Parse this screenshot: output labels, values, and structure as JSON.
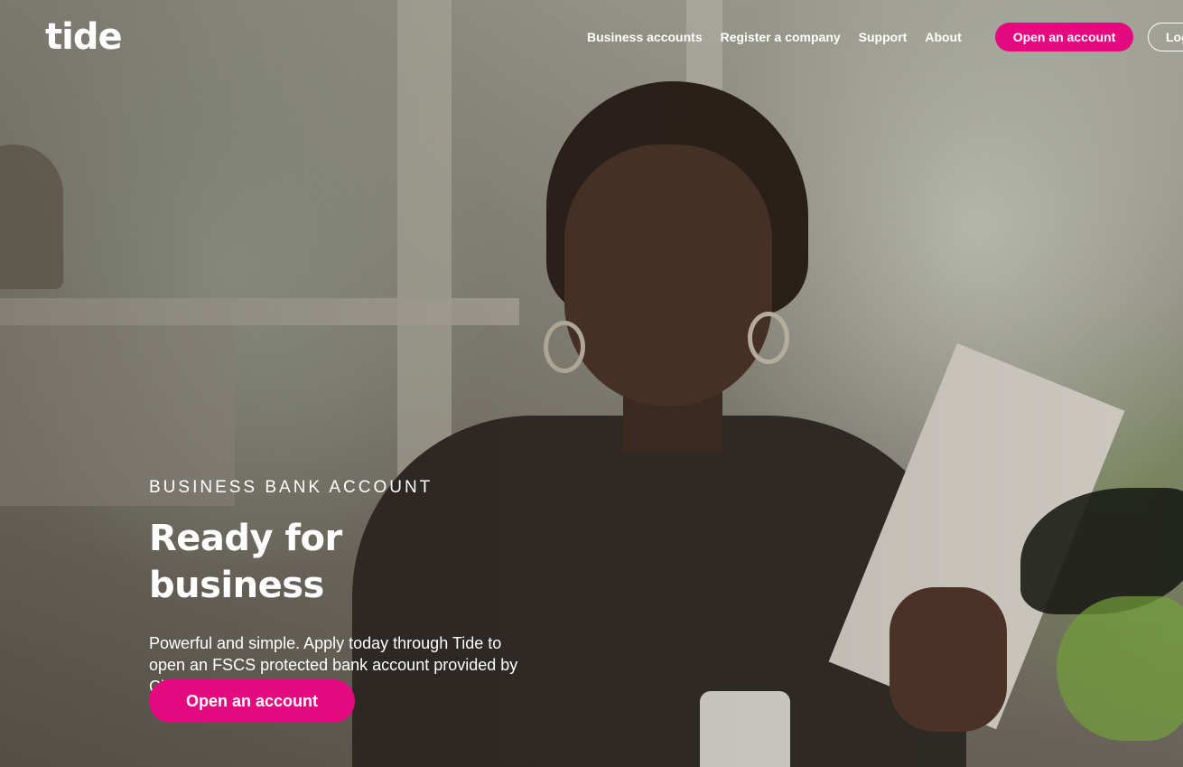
{
  "brand": {
    "logo_text": "tide",
    "accent_color": "#e5097f"
  },
  "nav": {
    "items": [
      {
        "label": "Business accounts"
      },
      {
        "label": "Register a company"
      },
      {
        "label": "Support"
      },
      {
        "label": "About"
      }
    ],
    "open_account_label": "Open an account",
    "login_label": "Log in"
  },
  "hero": {
    "eyebrow": "BUSINESS BANK ACCOUNT",
    "title": "Ready for business",
    "description": "Powerful and simple. Apply today through Tide to open an FSCS protected bank account provided by ClearBank.",
    "info_icon": "info-icon",
    "cta_label": "Open an account"
  }
}
